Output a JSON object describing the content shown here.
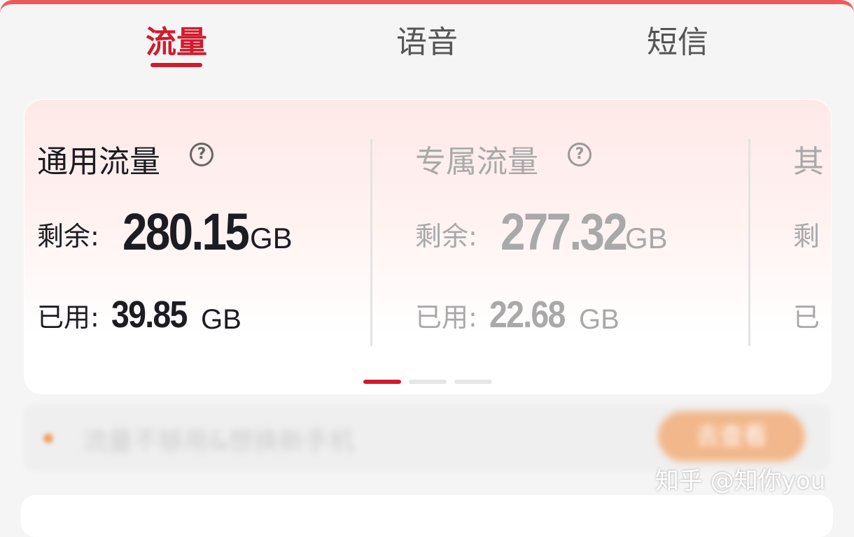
{
  "tabs": [
    {
      "label": "流量",
      "active": true
    },
    {
      "label": "语音",
      "active": false
    },
    {
      "label": "短信",
      "active": false
    }
  ],
  "cards": [
    {
      "title": "通用流量",
      "remain_label": "剩余:",
      "remain_value": "280.15",
      "remain_unit": "GB",
      "used_label": "已用:",
      "used_value": "39.85",
      "used_unit": "GB"
    },
    {
      "title": "专属流量",
      "remain_label": "剩余:",
      "remain_value": "277.32",
      "remain_unit": "GB",
      "used_label": "已用:",
      "used_value": "22.68",
      "used_unit": "GB"
    },
    {
      "title": "其",
      "remain_label": "剩",
      "used_label": "已"
    }
  ],
  "help_icon_glyph": "?",
  "pager": {
    "count": 3,
    "active_index": 0
  },
  "notice": {
    "text": "流量不够用&想换新手机",
    "button_label": "去查看"
  },
  "watermark": "知乎 @知你you",
  "colors": {
    "accent": "#d21a2d",
    "dark_text": "#1c1c22",
    "muted_text": "#a9a9a9",
    "notice_dot": "#f2a264"
  },
  "icons": {
    "help": "question-circle-icon",
    "notice": "dot-icon"
  }
}
